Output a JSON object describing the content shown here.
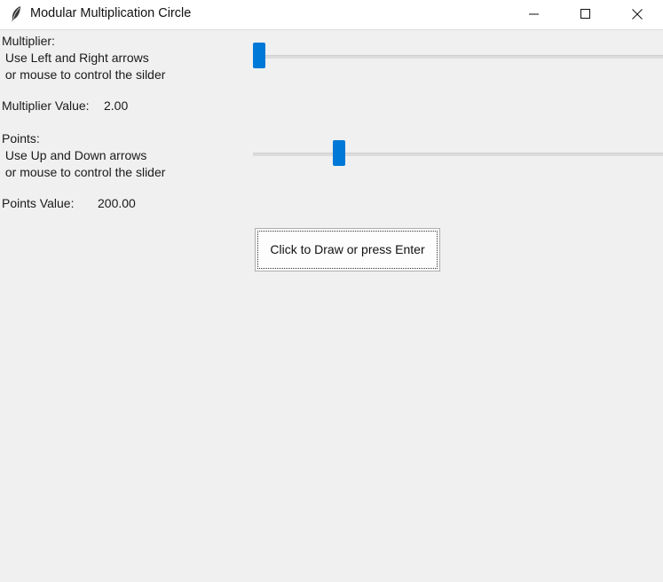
{
  "window": {
    "title": "Modular Multiplication Circle",
    "icon": "feather-icon"
  },
  "multiplier": {
    "label": "Multiplier:\n Use Left and Right arrows\n or mouse to control the silder",
    "value_label": "Multiplier Value:",
    "value": "2.00",
    "slider_position": 0.0
  },
  "points": {
    "label": "Points:\n Use Up and Down arrows\n or mouse to control the slider",
    "value_label": "Points Value:",
    "value": "200.00",
    "slider_position": 0.2
  },
  "draw_button": {
    "label": "Click to Draw or press Enter"
  },
  "colors": {
    "accent": "#0078d7",
    "background": "#f0f0f0",
    "titlebar": "#ffffff"
  }
}
